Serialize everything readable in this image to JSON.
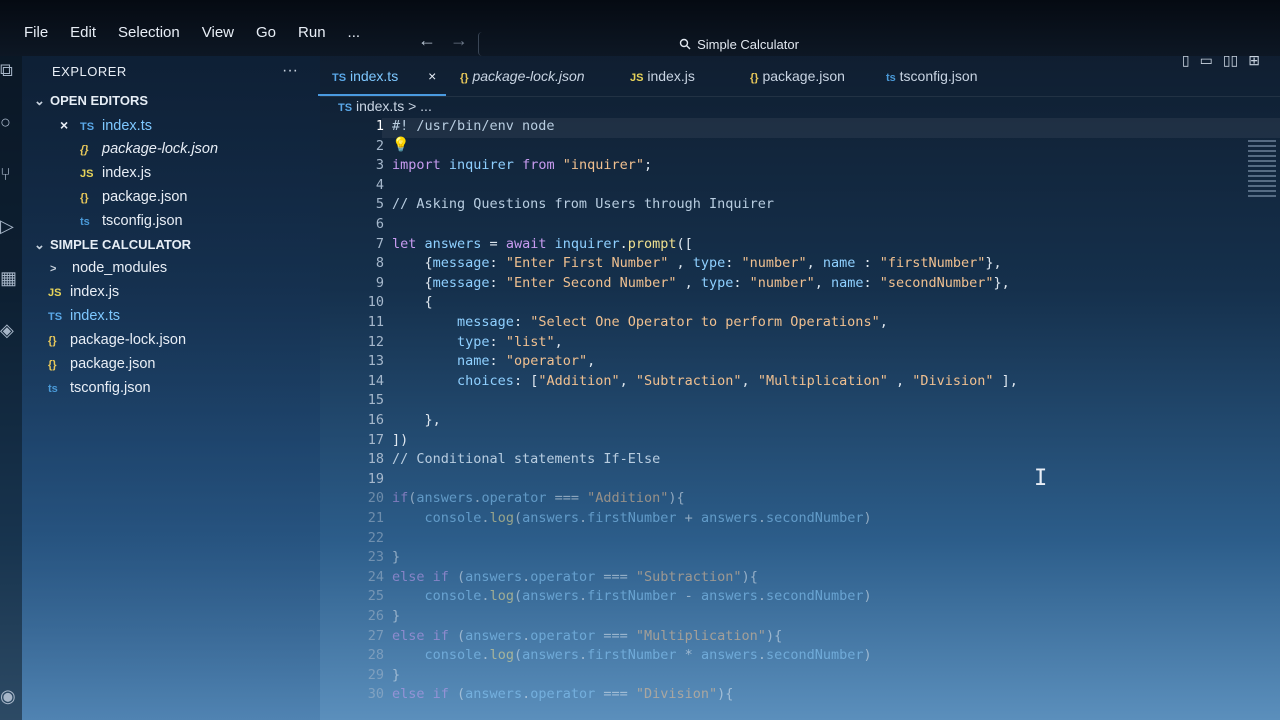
{
  "menu": [
    "File",
    "Edit",
    "Selection",
    "View",
    "Go",
    "Run",
    "..."
  ],
  "command_center": {
    "label": "Simple Calculator",
    "icon": "search-icon"
  },
  "nav": {
    "back": "←",
    "forward": "→"
  },
  "layout_buttons": [
    "▯",
    "▭",
    "▯▯",
    "⊞"
  ],
  "sidebar": {
    "header": "EXPLORER",
    "more": "···",
    "open_editors": {
      "title": "OPEN EDITORS",
      "items": [
        {
          "icon": "TS",
          "name": "index.ts",
          "close": "×"
        },
        {
          "icon": "{}",
          "name": "package-lock.json"
        },
        {
          "icon": "JS",
          "name": "index.js"
        },
        {
          "icon": "{}",
          "name": "package.json"
        },
        {
          "icon": "ts",
          "name": "tsconfig.json"
        }
      ]
    },
    "project": {
      "title": "SIMPLE CALCULATOR",
      "items": [
        {
          "icon": ">",
          "name": "node_modules"
        },
        {
          "icon": "JS",
          "name": "index.js"
        },
        {
          "icon": "TS",
          "name": "index.ts"
        },
        {
          "icon": "{}",
          "name": "package-lock.json"
        },
        {
          "icon": "{}",
          "name": "package.json"
        },
        {
          "icon": "ts",
          "name": "tsconfig.json"
        }
      ]
    }
  },
  "tabs": [
    {
      "icon": "TS",
      "name": "index.ts",
      "close": "×"
    },
    {
      "icon": "{}",
      "name": "package-lock.json"
    },
    {
      "icon": "JS",
      "name": "index.js"
    },
    {
      "icon": "{}",
      "name": "package.json"
    },
    {
      "icon": "ts",
      "name": "tsconfig.json"
    }
  ],
  "breadcrumb": {
    "icon": "TS",
    "file": "index.ts",
    "sep": ">",
    "rest": "..."
  },
  "code_lines": [
    {
      "n": "1",
      "parts": [
        [
          "cm",
          "#! /usr/bin/env node"
        ]
      ]
    },
    {
      "n": "2",
      "parts": []
    },
    {
      "n": "3",
      "parts": [
        [
          "kw",
          "import "
        ],
        [
          "id",
          "inquirer "
        ],
        [
          "kw",
          "from "
        ],
        [
          "str",
          "\"inquirer\""
        ],
        [
          "",
          ";"
        ]
      ]
    },
    {
      "n": "4",
      "parts": []
    },
    {
      "n": "5",
      "parts": [
        [
          "cm",
          "// Asking Questions from Users through Inquirer"
        ]
      ]
    },
    {
      "n": "6",
      "parts": []
    },
    {
      "n": "7",
      "parts": [
        [
          "kw",
          "let "
        ],
        [
          "id",
          "answers "
        ],
        [
          "",
          "= "
        ],
        [
          "kw",
          "await "
        ],
        [
          "id",
          "inquirer"
        ],
        [
          "",
          "."
        ],
        [
          "fn",
          "prompt"
        ],
        [
          "",
          "(["
        ]
      ]
    },
    {
      "n": "8",
      "parts": [
        [
          "",
          "    {"
        ],
        [
          "id",
          "message"
        ],
        [
          "",
          ": "
        ],
        [
          "str",
          "\"Enter First Number\""
        ],
        [
          "",
          " , "
        ],
        [
          "id",
          "type"
        ],
        [
          "",
          ": "
        ],
        [
          "str",
          "\"number\""
        ],
        [
          "",
          ", "
        ],
        [
          "id",
          "name"
        ],
        [
          "",
          " : "
        ],
        [
          "str",
          "\"firstNumber\""
        ],
        [
          "",
          "},"
        ]
      ]
    },
    {
      "n": "9",
      "parts": [
        [
          "",
          "    {"
        ],
        [
          "id",
          "message"
        ],
        [
          "",
          ": "
        ],
        [
          "str",
          "\"Enter Second Number\""
        ],
        [
          "",
          " , "
        ],
        [
          "id",
          "type"
        ],
        [
          "",
          ": "
        ],
        [
          "str",
          "\"number\""
        ],
        [
          "",
          ", "
        ],
        [
          "id",
          "name"
        ],
        [
          "",
          ": "
        ],
        [
          "str",
          "\"secondNumber\""
        ],
        [
          "",
          "},"
        ]
      ]
    },
    {
      "n": "10",
      "parts": [
        [
          "",
          "    {"
        ]
      ]
    },
    {
      "n": "11",
      "parts": [
        [
          "",
          "        "
        ],
        [
          "id",
          "message"
        ],
        [
          "",
          ": "
        ],
        [
          "str",
          "\"Select One Operator to perform Operations\""
        ],
        [
          "",
          ","
        ]
      ]
    },
    {
      "n": "12",
      "parts": [
        [
          "",
          "        "
        ],
        [
          "id",
          "type"
        ],
        [
          "",
          ": "
        ],
        [
          "str",
          "\"list\""
        ],
        [
          "",
          ","
        ]
      ]
    },
    {
      "n": "13",
      "parts": [
        [
          "",
          "        "
        ],
        [
          "id",
          "name"
        ],
        [
          "",
          ": "
        ],
        [
          "str",
          "\"operator\""
        ],
        [
          "",
          ","
        ]
      ]
    },
    {
      "n": "14",
      "parts": [
        [
          "",
          "        "
        ],
        [
          "id",
          "choices"
        ],
        [
          "",
          ": ["
        ],
        [
          "str",
          "\"Addition\""
        ],
        [
          "",
          ", "
        ],
        [
          "str",
          "\"Subtraction\""
        ],
        [
          "",
          ", "
        ],
        [
          "str",
          "\"Multiplication\""
        ],
        [
          "",
          " , "
        ],
        [
          "str",
          "\"Division\""
        ],
        [
          "",
          " ],"
        ]
      ]
    },
    {
      "n": "15",
      "parts": []
    },
    {
      "n": "16",
      "parts": [
        [
          "",
          "    },"
        ]
      ]
    },
    {
      "n": "17",
      "parts": [
        [
          "",
          "])"
        ]
      ]
    },
    {
      "n": "18",
      "parts": [
        [
          "cm",
          "// Conditional statements If-Else"
        ]
      ]
    },
    {
      "n": "19",
      "parts": []
    },
    {
      "n": "20",
      "parts": [
        [
          "kw",
          "if"
        ],
        [
          "",
          "("
        ],
        [
          "id",
          "answers"
        ],
        [
          "",
          "."
        ],
        [
          "id",
          "operator"
        ],
        [
          "",
          " === "
        ],
        [
          "str",
          "\"Addition\""
        ],
        [
          "",
          "){"
        ]
      ]
    },
    {
      "n": "21",
      "parts": [
        [
          "",
          "    "
        ],
        [
          "id",
          "console"
        ],
        [
          "",
          "."
        ],
        [
          "fn",
          "log"
        ],
        [
          "",
          "("
        ],
        [
          "id",
          "answers"
        ],
        [
          "",
          "."
        ],
        [
          "id",
          "firstNumber"
        ],
        [
          "",
          " + "
        ],
        [
          "id",
          "answers"
        ],
        [
          "",
          "."
        ],
        [
          "id",
          "secondNumber"
        ],
        [
          "",
          ")"
        ]
      ]
    },
    {
      "n": "22",
      "parts": []
    },
    {
      "n": "23",
      "parts": [
        [
          "",
          "}"
        ]
      ]
    },
    {
      "n": "24",
      "parts": [
        [
          "kw",
          "else if "
        ],
        [
          "",
          "("
        ],
        [
          "id",
          "answers"
        ],
        [
          "",
          "."
        ],
        [
          "id",
          "operator"
        ],
        [
          "",
          " === "
        ],
        [
          "str",
          "\"Subtraction\""
        ],
        [
          "",
          "){"
        ]
      ]
    },
    {
      "n": "25",
      "parts": [
        [
          "",
          "    "
        ],
        [
          "id",
          "console"
        ],
        [
          "",
          "."
        ],
        [
          "fn",
          "log"
        ],
        [
          "",
          "("
        ],
        [
          "id",
          "answers"
        ],
        [
          "",
          "."
        ],
        [
          "id",
          "firstNumber"
        ],
        [
          "",
          " - "
        ],
        [
          "id",
          "answers"
        ],
        [
          "",
          "."
        ],
        [
          "id",
          "secondNumber"
        ],
        [
          "",
          ")"
        ]
      ]
    },
    {
      "n": "26",
      "parts": [
        [
          "",
          "}"
        ]
      ]
    },
    {
      "n": "27",
      "parts": [
        [
          "kw",
          "else if "
        ],
        [
          "",
          "("
        ],
        [
          "id",
          "answers"
        ],
        [
          "",
          "."
        ],
        [
          "id",
          "operator"
        ],
        [
          "",
          " === "
        ],
        [
          "str",
          "\"Multiplication\""
        ],
        [
          "",
          "){"
        ]
      ]
    },
    {
      "n": "28",
      "parts": [
        [
          "",
          "    "
        ],
        [
          "id",
          "console"
        ],
        [
          "",
          "."
        ],
        [
          "fn",
          "log"
        ],
        [
          "",
          "("
        ],
        [
          "id",
          "answers"
        ],
        [
          "",
          "."
        ],
        [
          "id",
          "firstNumber"
        ],
        [
          "",
          " * "
        ],
        [
          "id",
          "answers"
        ],
        [
          "",
          "."
        ],
        [
          "id",
          "secondNumber"
        ],
        [
          "",
          ")"
        ]
      ]
    },
    {
      "n": "29",
      "parts": [
        [
          "",
          "}"
        ]
      ]
    },
    {
      "n": "30",
      "parts": [
        [
          "kw",
          "else if "
        ],
        [
          "",
          "("
        ],
        [
          "id",
          "answers"
        ],
        [
          "",
          "."
        ],
        [
          "id",
          "operator"
        ],
        [
          "",
          " === "
        ],
        [
          "str",
          "\"Division\""
        ],
        [
          "",
          "){"
        ]
      ]
    }
  ],
  "colors": {
    "accent": "#4a9ae0",
    "ts": "#5aa8e8",
    "js": "#e8d45a",
    "json": "#e8c85a"
  }
}
